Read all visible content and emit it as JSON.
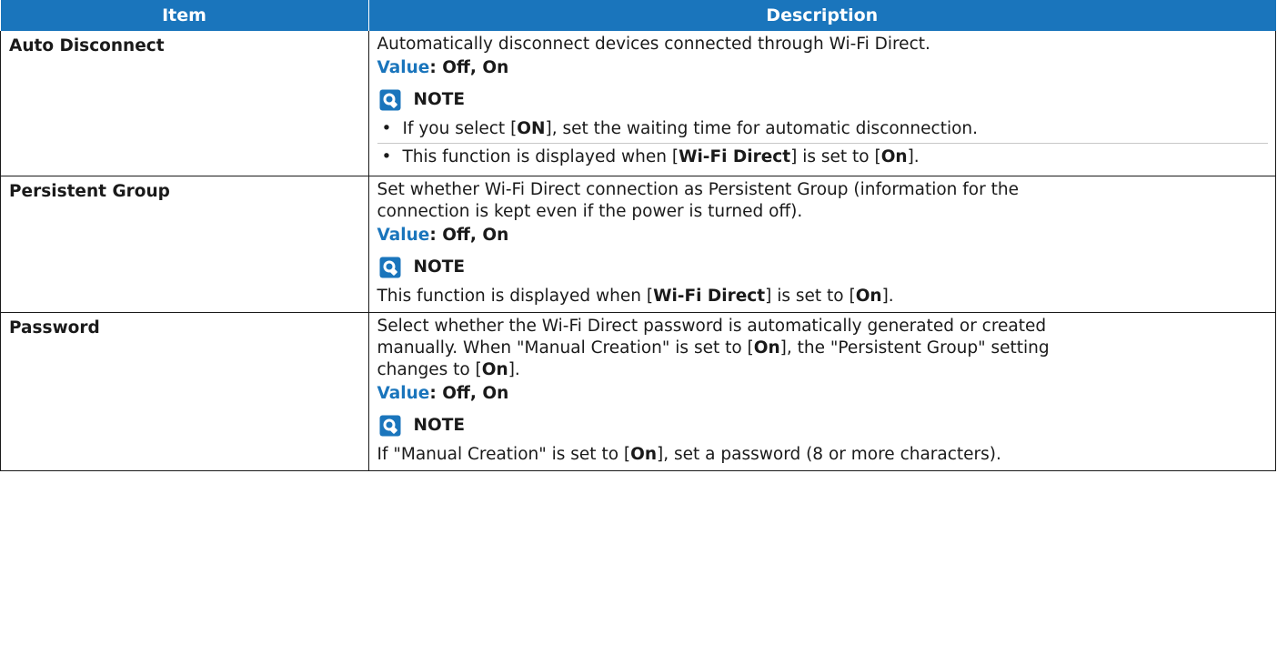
{
  "header": {
    "item": "Item",
    "description": "Description"
  },
  "rows": [
    {
      "item": "Auto Disconnect",
      "desc": "Automatically disconnect devices connected through Wi-Fi Direct.",
      "value_label": "Value",
      "value_text": ": Off, On",
      "note_label": "NOTE",
      "bullets": [
        [
          "If you select [",
          "ON",
          "], set the waiting time for automatic disconnection."
        ],
        [
          "This function is displayed when [",
          "Wi-Fi Direct",
          "] is set to [",
          "On",
          "]."
        ]
      ]
    },
    {
      "item": "Persistent Group",
      "desc1": "Set whether Wi-Fi Direct connection as Persistent Group (information for the",
      "desc2": "connection is kept even if the power is turned off).",
      "value_label": "Value",
      "value_text": ": Off, On",
      "note_label": "NOTE",
      "note": [
        "This function is displayed when [",
        "Wi-Fi Direct",
        "] is set to [",
        "On",
        "]."
      ]
    },
    {
      "item": "Password",
      "desc1": "Select whether the Wi-Fi Direct password is automatically generated or created",
      "desc2": [
        "manually. When \"Manual Creation\" is set to [",
        "On",
        "], the \"Persistent Group\" setting"
      ],
      "desc3": [
        "changes to [",
        "On",
        "]."
      ],
      "value_label": "Value",
      "value_text": ": Off, On",
      "note_label": "NOTE",
      "note": [
        "If \"Manual Creation\" is set to [",
        "On",
        "], set a password (8 or more characters)."
      ]
    }
  ],
  "bullet_glyph": "•",
  "colors": {
    "header_bg": "#1a75bc",
    "value_label": "#1a75bc",
    "note_icon": "#1a75bc"
  },
  "icons": {
    "note": "lightbulb-note-icon"
  }
}
